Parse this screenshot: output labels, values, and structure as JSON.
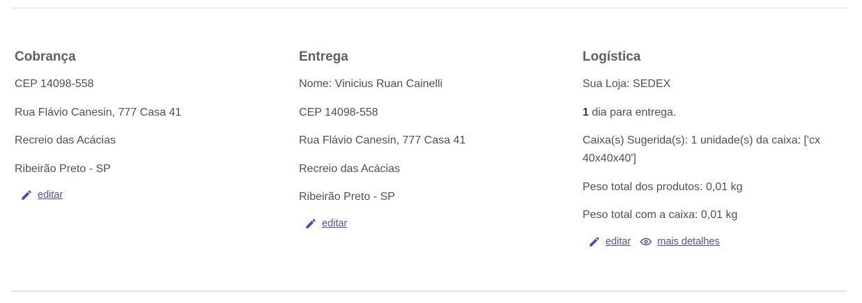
{
  "colors": {
    "link": "#4f4fa8",
    "heading": "#5c5e70",
    "text": "#4d4f5c"
  },
  "billing": {
    "title": "Cobrança",
    "lines": [
      "CEP 14098-558",
      "Rua Flávio Canesin, 777 Casa 41",
      "Recreio das Acácias",
      "Ribeirão Preto - SP"
    ],
    "edit_label": "editar",
    "edit_icon": "pencil-icon"
  },
  "delivery": {
    "title": "Entrega",
    "lines": [
      "Nome: Vinicius Ruan Cainelli",
      "CEP 14098-558",
      "Rua Flávio Canesin, 777 Casa 41",
      "Recreio das Acácias",
      "Ribeirão Preto - SP"
    ],
    "edit_label": "editar",
    "edit_icon": "pencil-icon"
  },
  "logistics": {
    "title": "Logística",
    "store_line": "Sua Loja: SEDEX",
    "days_count": "1",
    "days_text": " dia para entrega.",
    "box_line": "Caixa(s) Sugerida(s): 1 unidade(s) da caixa: ['cx 40x40x40']",
    "product_weight": "Peso total dos produtos: 0,01 kg",
    "box_weight": "Peso total com a caixa: 0,01 kg",
    "edit_label": "editar",
    "edit_icon": "pencil-icon",
    "details_label": "mais detalhes",
    "details_icon": "eye-icon"
  }
}
